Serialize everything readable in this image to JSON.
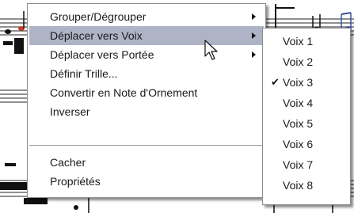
{
  "context_menu": {
    "items": [
      {
        "label": "Grouper/Dégrouper",
        "submenu": true
      },
      {
        "label": "Déplacer vers Voix",
        "submenu": true,
        "highlighted": true
      },
      {
        "label": "Déplacer vers Portée",
        "submenu": true
      },
      {
        "label": "Définir Trille...",
        "submenu": false
      },
      {
        "label": "Convertir en Note d'Ornement",
        "submenu": false
      },
      {
        "label": "Inverser",
        "submenu": false
      },
      {
        "label": "Cacher",
        "submenu": false
      },
      {
        "label": "Propriétés",
        "submenu": false
      }
    ]
  },
  "voice_submenu": {
    "items": [
      {
        "label": "Voix 1"
      },
      {
        "label": "Voix 2"
      },
      {
        "label": "Voix 3",
        "checked": true
      },
      {
        "label": "Voix 4"
      },
      {
        "label": "Voix 5"
      },
      {
        "label": "Voix 6"
      },
      {
        "label": "Voix 7"
      },
      {
        "label": "Voix 8"
      }
    ],
    "check_glyph": "✔"
  },
  "colors": {
    "highlight": "#aeb4c6",
    "score_accent": "#3a4fa0"
  },
  "icons": {
    "cursor": "arrow-pointer-icon"
  }
}
